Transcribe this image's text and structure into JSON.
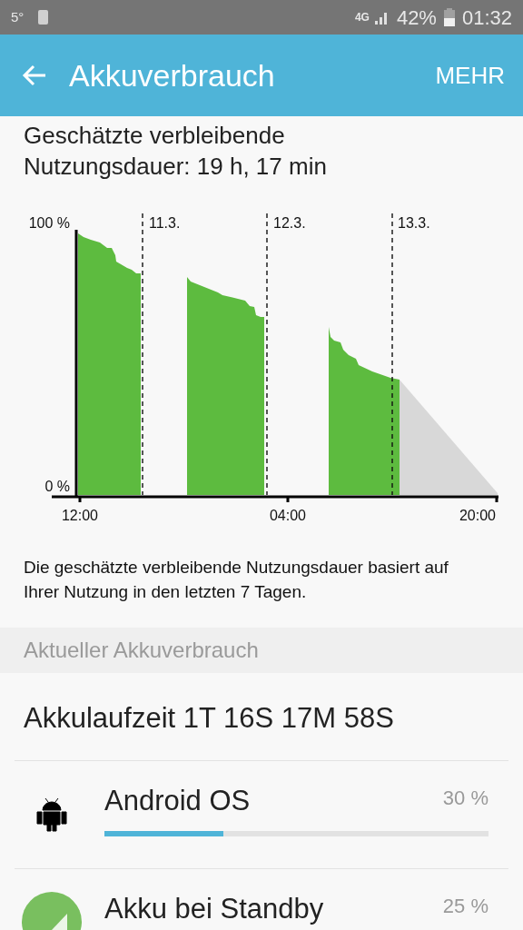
{
  "status_bar": {
    "temperature": "5°",
    "network": "4G",
    "battery": "42%",
    "time": "01:32"
  },
  "app_bar": {
    "title": "Akkuverbrauch",
    "action": "MEHR"
  },
  "estimate": "Geschätzte verbleibende Nutzungsdauer: 19 h, 17 min",
  "chart": {
    "y_labels": [
      "100 %",
      "0 %"
    ],
    "day_labels": [
      "11.3.",
      "12.3.",
      "13.3."
    ],
    "time_labels": [
      "12:00",
      "04:00",
      "20:00"
    ]
  },
  "note": "Die geschätzte verbleibende Nutzungsdauer basiert auf Ihrer Nutzung in den letzten 7 Tagen.",
  "section_header": "Aktueller Akkuverbrauch",
  "battery_time": "Akkulaufzeit 1T 16S 17M 58S",
  "apps": [
    {
      "kind": "android",
      "name": "Android OS",
      "percent": "30 %",
      "level": 0.31
    },
    {
      "kind": "standby",
      "name": "Akku bei Standby",
      "percent": "25 %"
    }
  ]
}
